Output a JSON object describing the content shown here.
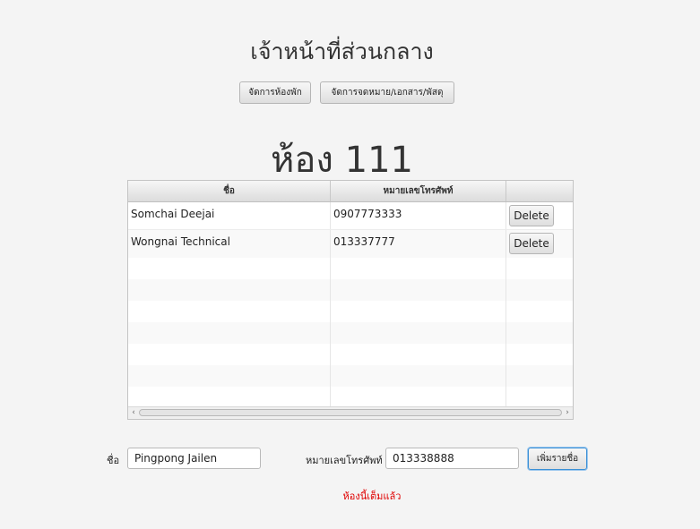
{
  "header": {
    "title": "เจ้าหน้าที่ส่วนกลาง",
    "nav_buttons": [
      {
        "label": "จัดการห้องพัก"
      },
      {
        "label": "จัดการจดหมาย/เอกสาร/พัสดุ"
      }
    ]
  },
  "room": {
    "title": "ห้อง 111"
  },
  "table": {
    "columns": [
      "ชื่อ",
      "หมายเลขโทรศัพท์",
      ""
    ],
    "rows": [
      {
        "name": "Somchai Deejai",
        "phone": "0907773333",
        "action": "Delete"
      },
      {
        "name": "Wongnai Technical",
        "phone": "013337777",
        "action": "Delete"
      }
    ]
  },
  "form": {
    "name_label": "ชื่อ",
    "name_value": "Pingpong Jailen",
    "phone_label": "หมายเลขโทรศัพท์",
    "phone_value": "013338888",
    "add_button_label": "เพิ่มรายชื่อ"
  },
  "status": {
    "error_message": "ห้องนี้เต็มแล้ว",
    "error_color": "#e00000"
  },
  "colors": {
    "focus_accent": "#3a8fd6"
  }
}
